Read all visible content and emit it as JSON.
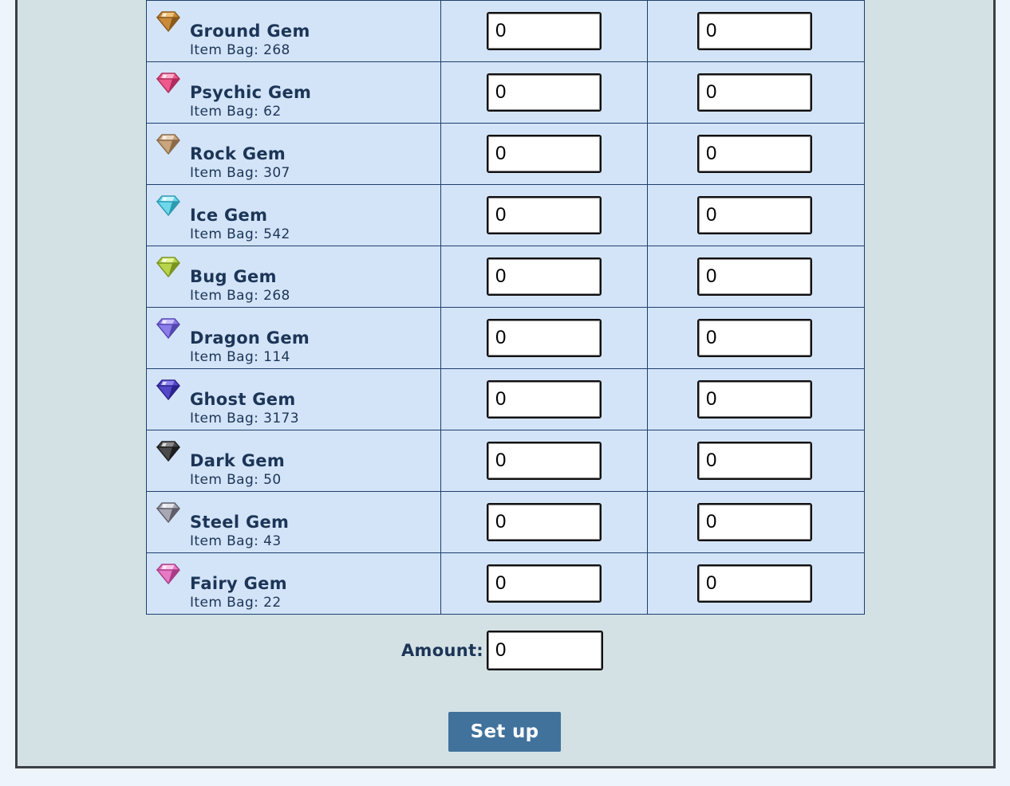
{
  "gems": [
    {
      "name": "Ground Gem",
      "bag": "Item Bag: 268",
      "icon": "ground-gem-icon",
      "color": "#c98b3a",
      "dark": "#8a5a1c",
      "light": "#f0c27a",
      "val1": "0",
      "val2": "0"
    },
    {
      "name": "Psychic Gem",
      "bag": "Item Bag: 62",
      "icon": "psychic-gem-icon",
      "color": "#ee5a8c",
      "dark": "#b02c5e",
      "light": "#ffb0cc",
      "val1": "0",
      "val2": "0"
    },
    {
      "name": "Rock Gem",
      "bag": "Item Bag: 307",
      "icon": "rock-gem-icon",
      "color": "#c9a57e",
      "dark": "#8a6a48",
      "light": "#ecd6bc",
      "val1": "0",
      "val2": "0"
    },
    {
      "name": "Ice Gem",
      "bag": "Item Bag: 542",
      "icon": "ice-gem-icon",
      "color": "#6ed7ea",
      "dark": "#2d9ab0",
      "light": "#c4f4fc",
      "val1": "0",
      "val2": "0"
    },
    {
      "name": "Bug Gem",
      "bag": "Item Bag: 268",
      "icon": "bug-gem-icon",
      "color": "#b8d44a",
      "dark": "#7a9420",
      "light": "#e6f59c",
      "val1": "0",
      "val2": "0"
    },
    {
      "name": "Dragon Gem",
      "bag": "Item Bag: 114",
      "icon": "dragon-gem-icon",
      "color": "#8c7ee8",
      "dark": "#5346b0",
      "light": "#c9c0ff",
      "val1": "0",
      "val2": "0"
    },
    {
      "name": "Ghost Gem",
      "bag": "Item Bag: 3173",
      "icon": "ghost-gem-icon",
      "color": "#5448c8",
      "dark": "#2c228a",
      "light": "#8d84f0",
      "val1": "0",
      "val2": "0"
    },
    {
      "name": "Dark Gem",
      "bag": "Item Bag: 50",
      "icon": "dark-gem-icon",
      "color": "#4a4a4a",
      "dark": "#1e1e1e",
      "light": "#8a8a8a",
      "val1": "0",
      "val2": "0"
    },
    {
      "name": "Steel Gem",
      "bag": "Item Bag: 43",
      "icon": "steel-gem-icon",
      "color": "#a8a8b4",
      "dark": "#5e5e6a",
      "light": "#e4e4ec",
      "val1": "0",
      "val2": "0"
    },
    {
      "name": "Fairy Gem",
      "bag": "Item Bag: 22",
      "icon": "fairy-gem-icon",
      "color": "#e87ac4",
      "dark": "#a83c86",
      "light": "#ffc4ea",
      "val1": "0",
      "val2": "0"
    }
  ],
  "amount": {
    "label": "Amount:",
    "value": "0"
  },
  "setup_button": {
    "label": "Set up"
  },
  "colors": {
    "panel_bg": "#d3e1e4",
    "cell_bg": "#d3e4f8",
    "text": "#1c3557",
    "button_bg": "#41729c"
  }
}
